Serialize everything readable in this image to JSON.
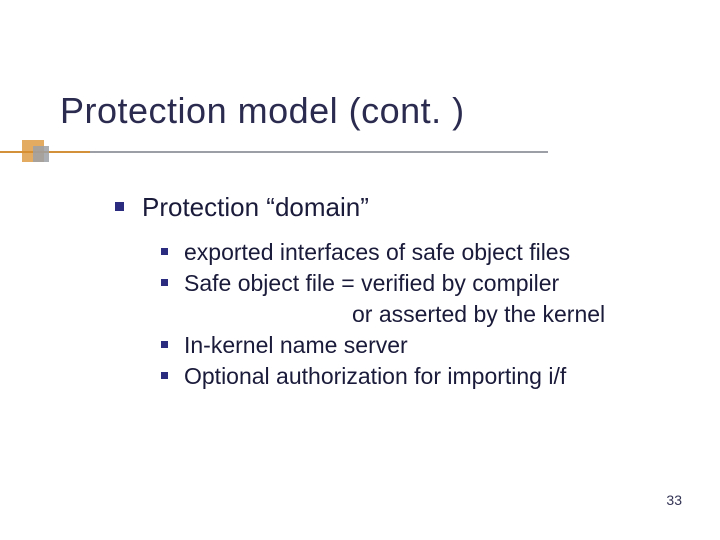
{
  "title": "Protection model (cont. )",
  "lvl1": {
    "text": "Protection “domain”"
  },
  "lvl2": [
    {
      "text": "exported interfaces of safe object files"
    },
    {
      "text": "Safe object file = verified by compiler",
      "cont": "or asserted by the kernel"
    },
    {
      "text": "In-kernel name server"
    },
    {
      "text": "Optional authorization for importing i/f"
    }
  ],
  "page_number": "33"
}
